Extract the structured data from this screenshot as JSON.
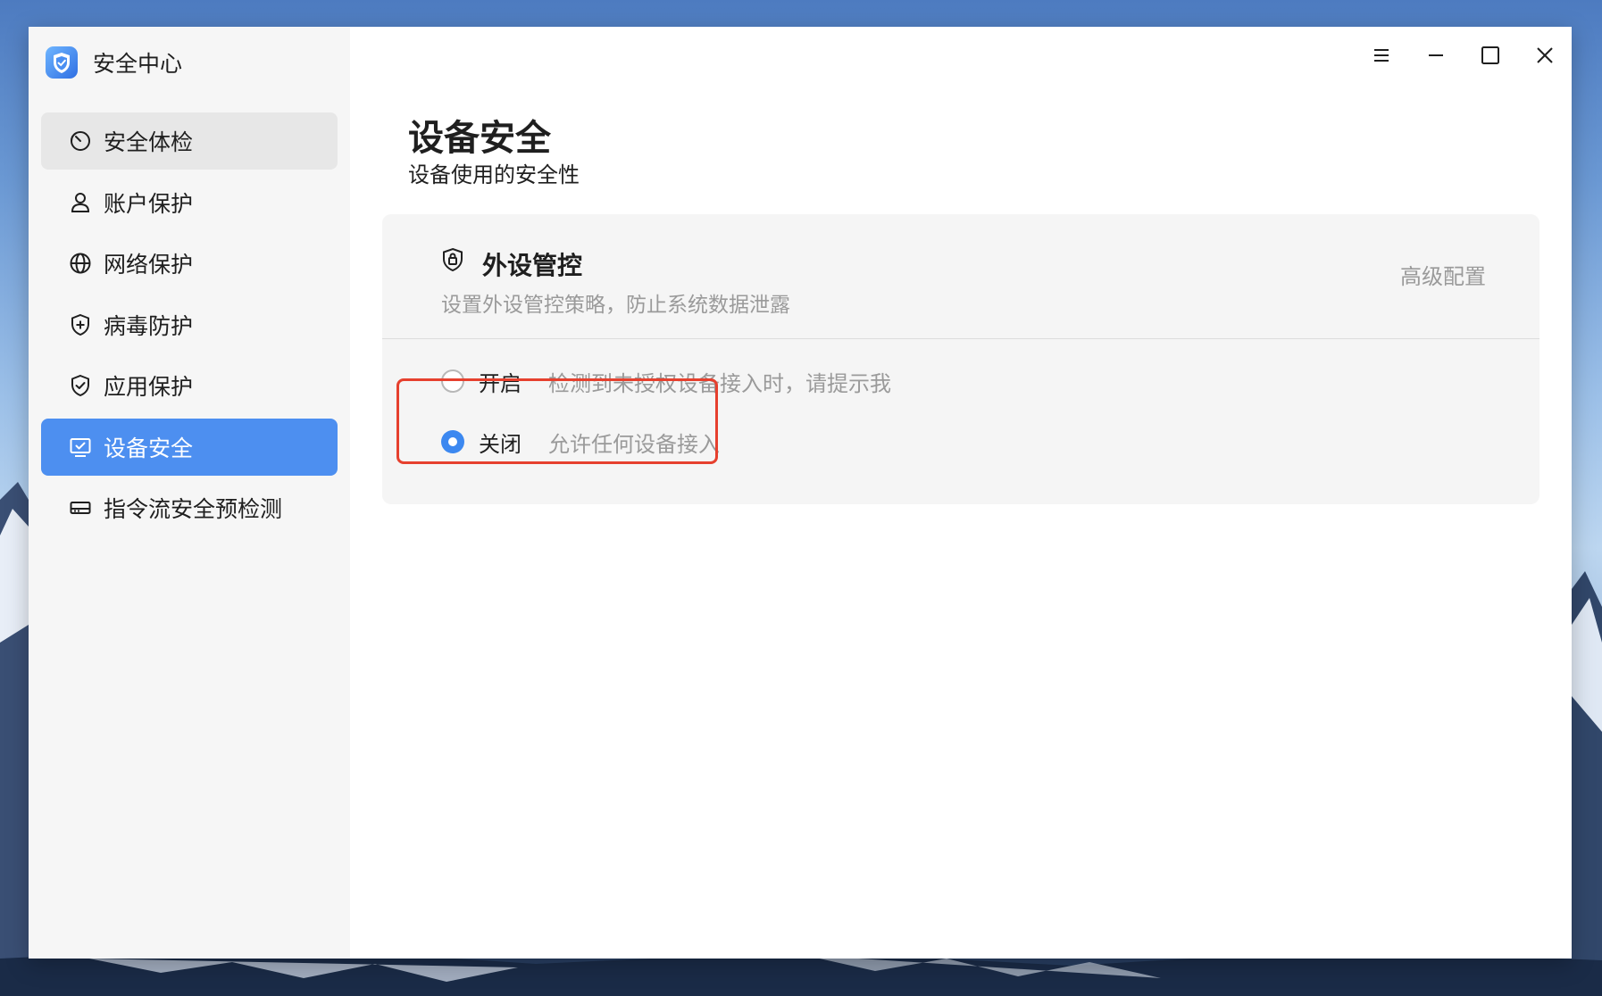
{
  "app": {
    "title": "安全中心",
    "accent_color": "#4d8ff0"
  },
  "sidebar": {
    "items": [
      {
        "label": "安全体检",
        "icon": "scan-icon",
        "state": "hover"
      },
      {
        "label": "账户保护",
        "icon": "user-icon",
        "state": ""
      },
      {
        "label": "网络保护",
        "icon": "globe-icon",
        "state": ""
      },
      {
        "label": "病毒防护",
        "icon": "shield-plus-icon",
        "state": ""
      },
      {
        "label": "应用保护",
        "icon": "shield-check-icon",
        "state": ""
      },
      {
        "label": "设备安全",
        "icon": "monitor-check-icon",
        "state": "active"
      },
      {
        "label": "指令流安全预检测",
        "icon": "drive-icon",
        "state": ""
      }
    ]
  },
  "window_controls": [
    "menu-icon",
    "minimize-icon",
    "maximize-icon",
    "close-icon"
  ],
  "main": {
    "title": "设备安全",
    "subtitle": "设备使用的安全性",
    "card": {
      "icon": "shield-lock-icon",
      "title": "外设管控",
      "description": "设置外设管控策略，防止系统数据泄露",
      "advanced_label": "高级配置",
      "options": [
        {
          "label": "开启",
          "description": "检测到未授权设备接入时，请提示我",
          "checked": false
        },
        {
          "label": "关闭",
          "description": "允许任何设备接入",
          "checked": true
        }
      ]
    }
  },
  "highlight_color": "#e6402e"
}
